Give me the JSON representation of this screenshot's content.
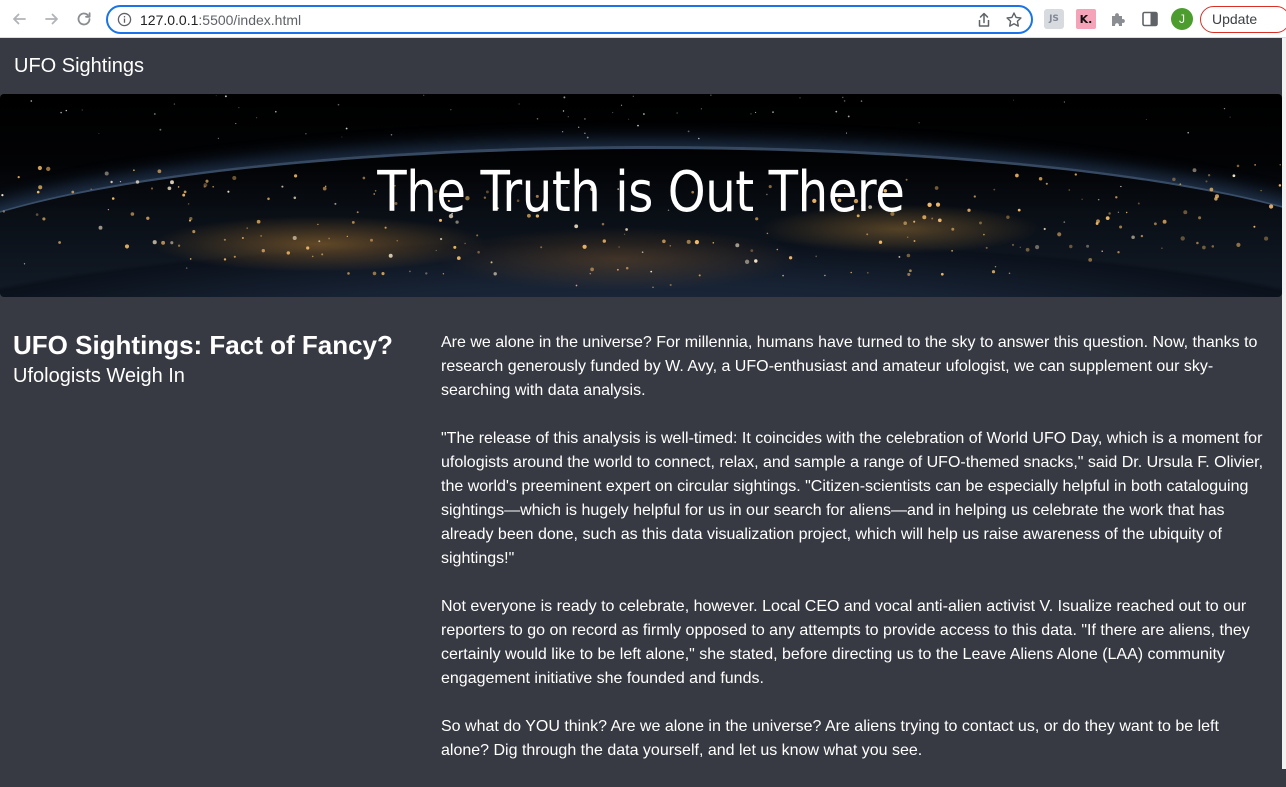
{
  "browser": {
    "url_host": "127.0.0.1",
    "url_path": ":5500/index.html",
    "extensions": {
      "js_label": "JS",
      "k_label": "K."
    },
    "profile_initial": "J",
    "update_label": "Update"
  },
  "navbar": {
    "brand": "UFO Sightings"
  },
  "hero": {
    "title": "The Truth is Out There"
  },
  "article": {
    "title": "UFO Sightings: Fact of Fancy?",
    "subtitle": "Ufologists Weigh In",
    "paragraphs": [
      "Are we alone in the universe? For millennia, humans have turned to the sky to answer this question. Now, thanks to research generously funded by W. Avy, a UFO-enthusiast and amateur ufologist, we can supplement our sky-searching with data analysis.",
      "\"The release of this analysis is well-timed: It coincides with the celebration of World UFO Day, which is a moment for ufologists around the world to connect, relax, and sample a range of UFO-themed snacks,\" said Dr. Ursula F. Olivier, the world's preeminent expert on circular sightings. \"Citizen-scientists can be especially helpful in both cataloguing sightings—which is hugely helpful for us in our search for aliens—and in helping us celebrate the work that has already been done, such as this data visualization project, which will help us raise awareness of the ubiquity of sightings!\"",
      "Not everyone is ready to celebrate, however. Local CEO and vocal anti-alien activist V. Isualize reached out to our reporters to go on record as firmly opposed to any attempts to provide access to this data. \"If there are aliens, they certainly would like to be left alone,\" she stated, before directing us to the Leave Aliens Alone (LAA) community engagement initiative she founded and funds.",
      "So what do YOU think? Are we alone in the universe? Are aliens trying to contact us, or do they want to be left alone? Dig through the data yourself, and let us know what you see."
    ]
  },
  "colors": {
    "page_background": "#373a42",
    "text": "#ffffff",
    "omnibox_focus": "#1a73e8",
    "update_border": "#d93025",
    "avatar": "#4c9c2e"
  },
  "icons": [
    "back-icon",
    "forward-icon",
    "reload-icon",
    "info-icon",
    "share-icon",
    "star-icon",
    "puzzle-icon",
    "side-panel-icon"
  ]
}
